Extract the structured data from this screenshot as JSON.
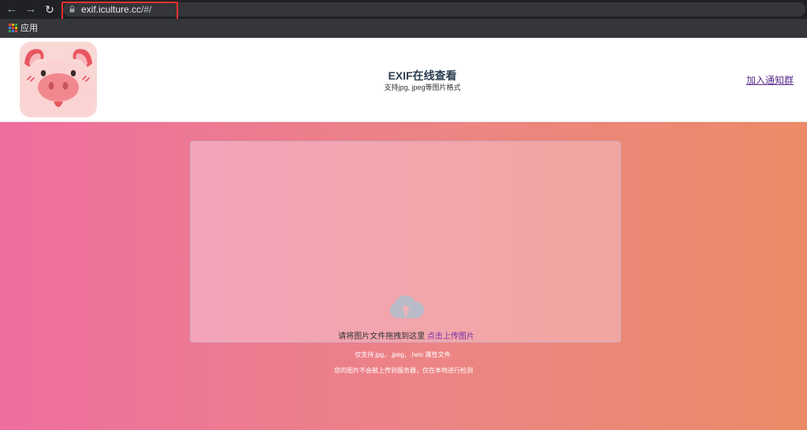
{
  "browser": {
    "url_host": "exif.iculture.cc",
    "url_rest": "/#/",
    "bookmark_apps_label": "应用",
    "icons": {
      "back": "arrow-left-icon",
      "forward": "arrow-right-icon",
      "reload": "reload-icon",
      "lock": "lock-icon",
      "apps": "apps-grid-icon"
    }
  },
  "header": {
    "title": "EXIF在线查看",
    "subtitle": "支持jpg, jpeg等图片格式",
    "join_link": "加入通知群",
    "logo_icon": "pig-logo-icon"
  },
  "upload": {
    "drop_text": "请将图片文件拖拽到这里 ",
    "pick_link": "点击上传图片",
    "icon": "cloud-upload-icon",
    "note_formats": "仅支持.jpg，.jpeg，.heic 属性文件.",
    "note_privacy": "您的图片不会被上传到服务器，仅在本地进行检测"
  },
  "colors": {
    "gradient_start": "#ee6e9f",
    "gradient_end": "#ec8a68",
    "highlight_box": "#e5322d",
    "link": "#7b2ea8"
  }
}
